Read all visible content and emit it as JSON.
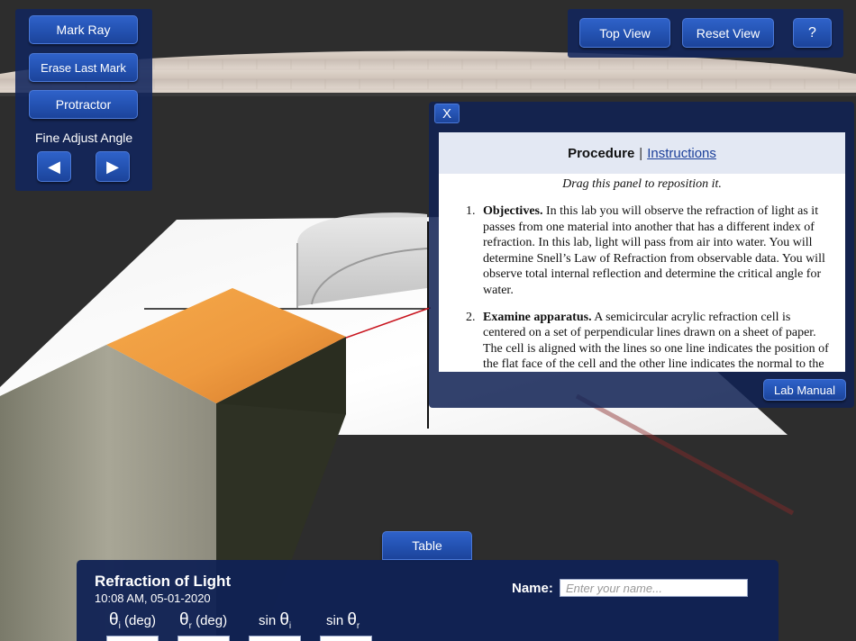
{
  "left_panel": {
    "mark_ray": "Mark Ray",
    "erase_last_mark": "Erase Last Mark",
    "protractor": "Protractor",
    "fine_adjust_label": "Fine Adjust Angle",
    "arrow_left": "◀",
    "arrow_right": "▶"
  },
  "top_right": {
    "top_view": "Top View",
    "reset_view": "Reset View",
    "help": "?"
  },
  "procedure": {
    "close": "X",
    "title": "Procedure",
    "separator": "|",
    "instructions_link": "Instructions",
    "drag_hint": "Drag this panel to reposition it.",
    "items": [
      {
        "num": "1.",
        "heading": "Objectives.",
        "text": " In this lab you will observe the refraction of light as it passes from one material into another that has a different index of refraction. In this lab, light will pass from air into water. You will determine Snell’s Law of Refraction from observable data. You will observe total internal reflection and determine the critical angle for water."
      },
      {
        "num": "2.",
        "heading": "Examine apparatus.",
        "text": " A semicircular acrylic refraction cell is centered on a set of perpendicular lines drawn on a sheet of paper. The cell is aligned with the lines so one line indicates the position of the flat face of the cell and the other line indicates the normal to the"
      }
    ],
    "lab_manual": "Lab Manual"
  },
  "table_tab": "Table",
  "data_panel": {
    "title": "Refraction of Light",
    "timestamp": "10:08 AM, 05-01-2020",
    "name_label": "Name:",
    "name_placeholder": "Enter your name...",
    "name_value": "",
    "columns": [
      {
        "symbol": "θ",
        "sub": "i",
        "suffix": " (deg)",
        "prefix": ""
      },
      {
        "symbol": "θ",
        "sub": "r",
        "suffix": " (deg)",
        "prefix": ""
      },
      {
        "symbol": "θ",
        "sub": "i",
        "suffix": "",
        "prefix": "sin "
      },
      {
        "symbol": "θ",
        "sub": "r",
        "suffix": "",
        "prefix": "sin "
      }
    ]
  },
  "colors": {
    "panel": "#12265c",
    "button": "#2453b3",
    "laser_beam": "#c8141e",
    "light_box_face": "#e8923a"
  }
}
